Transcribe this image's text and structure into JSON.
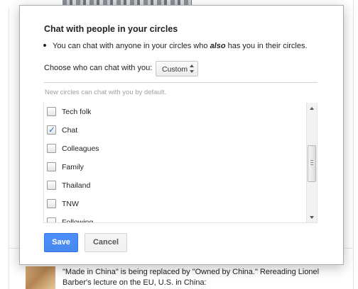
{
  "dialog": {
    "title": "Chat with people in your circles",
    "bullet_text_pre": "You can chat with anyone in your circles who ",
    "bullet_text_emph": "also",
    "bullet_text_post": " has you in their circles.",
    "choose_label": "Choose who can chat with you:",
    "select_value": "Custom",
    "hint": "New circles can chat with you by default.",
    "circles": [
      {
        "label": "Tech folk",
        "checked": false
      },
      {
        "label": "Chat",
        "checked": true
      },
      {
        "label": "Colleagues",
        "checked": false
      },
      {
        "label": "Family",
        "checked": false
      },
      {
        "label": "Thailand",
        "checked": false
      },
      {
        "label": "TNW",
        "checked": false
      },
      {
        "label": "Following",
        "checked": false
      }
    ],
    "save_label": "Save",
    "cancel_label": "Cancel"
  },
  "background": {
    "post_text": "\"Made in China\" is being replaced by \"Owned by China.\" Rereading Lionel Barber's lecture on the EU, U.S. in China:"
  },
  "colors": {
    "save_button": "#4d90fe",
    "checkmark": "#3b6fd4"
  }
}
